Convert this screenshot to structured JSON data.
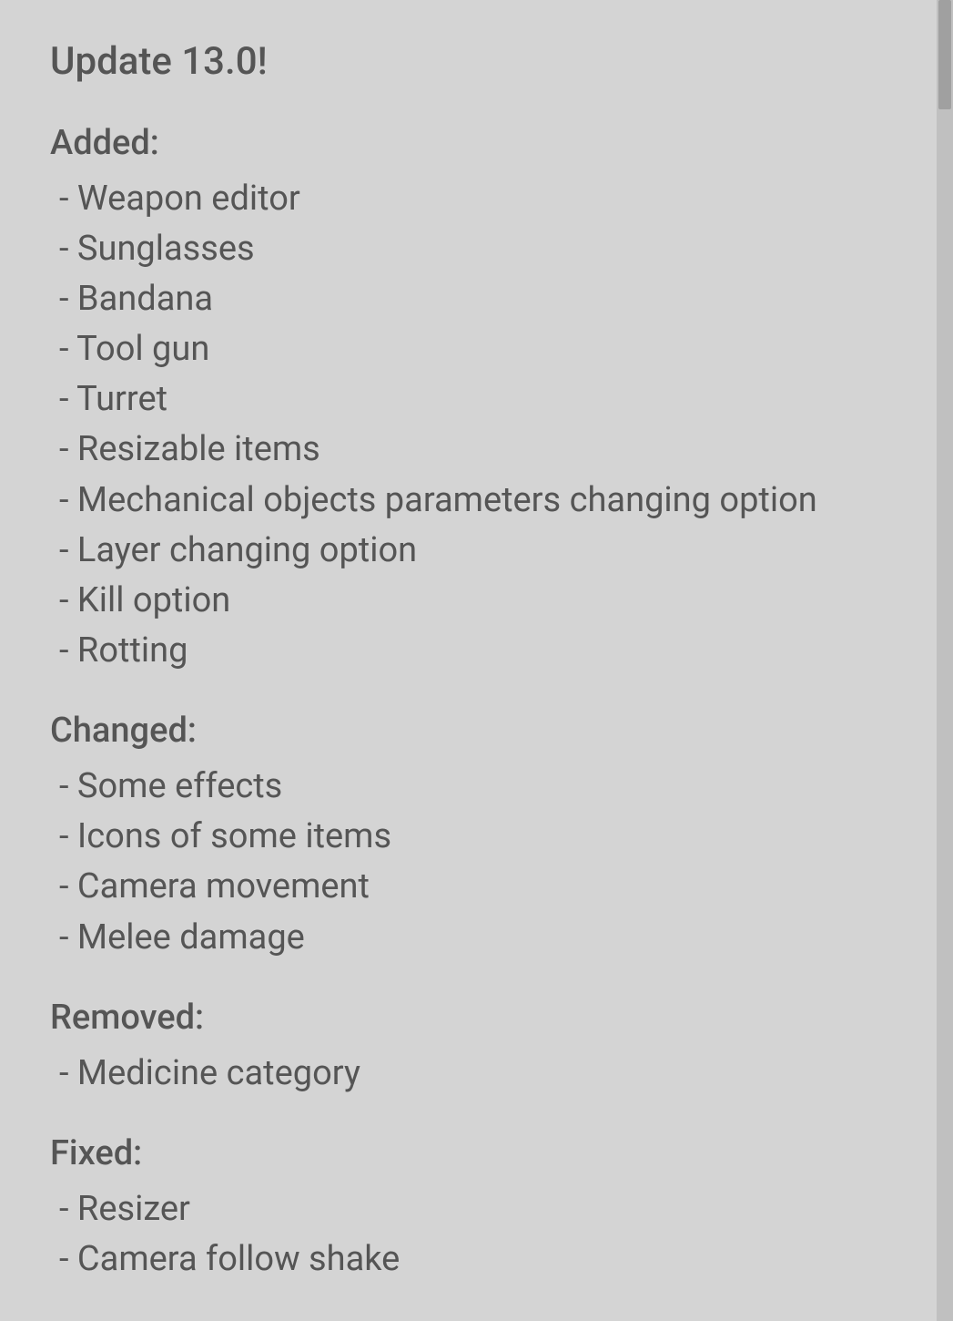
{
  "page": {
    "title": "Update 13.0!",
    "sections": [
      {
        "id": "added",
        "header": "Added:",
        "items": [
          "- Weapon editor",
          "- Sunglasses",
          "- Bandana",
          "- Tool gun",
          "- Turret",
          "- Resizable items",
          "- Mechanical objects parameters changing option",
          "- Layer changing option",
          "- Kill option",
          "- Rotting"
        ]
      },
      {
        "id": "changed",
        "header": "Changed:",
        "items": [
          "- Some effects",
          "- Icons of some items",
          "- Camera movement",
          "- Melee damage"
        ]
      },
      {
        "id": "removed",
        "header": "Removed:",
        "items": [
          "- Medicine category"
        ]
      },
      {
        "id": "fixed",
        "header": "Fixed:",
        "items": [
          "- Resizer",
          "- Camera follow shake"
        ]
      }
    ]
  }
}
